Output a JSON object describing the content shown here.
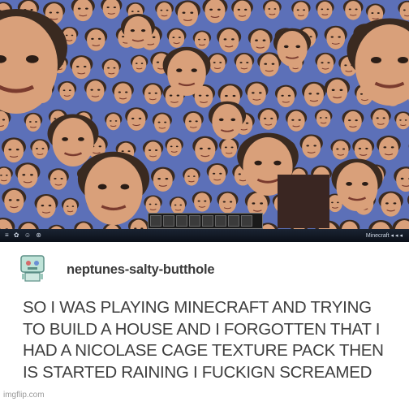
{
  "screenshot": {
    "sky_color": "#5c70b8",
    "face_skin": "#d9a07a",
    "hair_color": "#3a2a20",
    "taskbar_left": "≡ ✿ ☺ ⊛",
    "taskbar_right": "Minecraft  ◂ ◂ ◂"
  },
  "author": {
    "username": "neptunes-salty-butthole",
    "avatar": "robot-avatar-icon"
  },
  "post": {
    "line1": "SO I WAS PLAYING MINECRAFT AND TRYING",
    "line2": "TO BUILD A HOUSE AND I FORGOTTEN THAT I",
    "line3": "HAD A NICOLASE CAGE TEXTURE PACK THEN",
    "line4": "IS STARTED RAINING I FUCKIGN SCREAMED"
  },
  "watermark": "imgflip.com"
}
